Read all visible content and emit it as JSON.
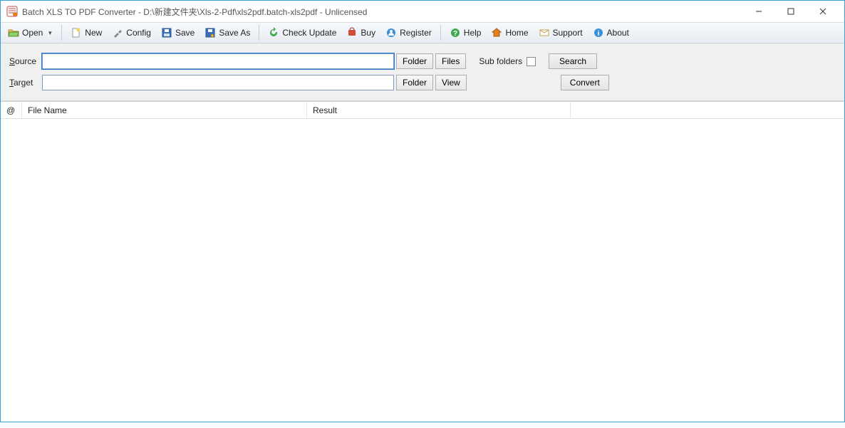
{
  "window": {
    "title": "Batch XLS TO PDF Converter - D:\\新建文件夹\\Xls-2-Pdf\\xls2pdf.batch-xls2pdf - Unlicensed"
  },
  "toolbar": {
    "open": "Open",
    "new": "New",
    "config": "Config",
    "save": "Save",
    "save_as": "Save As",
    "check_update": "Check Update",
    "buy": "Buy",
    "register": "Register",
    "help": "Help",
    "home": "Home",
    "support": "Support",
    "about": "About"
  },
  "paths": {
    "source_label_prefix": "S",
    "source_label_rest": "ource",
    "target_label_prefix": "T",
    "target_label_rest": "arget",
    "source_value": "",
    "target_value": "",
    "folder_btn": "Folder",
    "files_btn": "Files",
    "view_btn": "View",
    "subfolders_label": "Sub folders",
    "search_btn": "Search",
    "convert_btn": "Convert"
  },
  "table": {
    "col_at": "@",
    "col_filename": "File Name",
    "col_result": "Result"
  }
}
